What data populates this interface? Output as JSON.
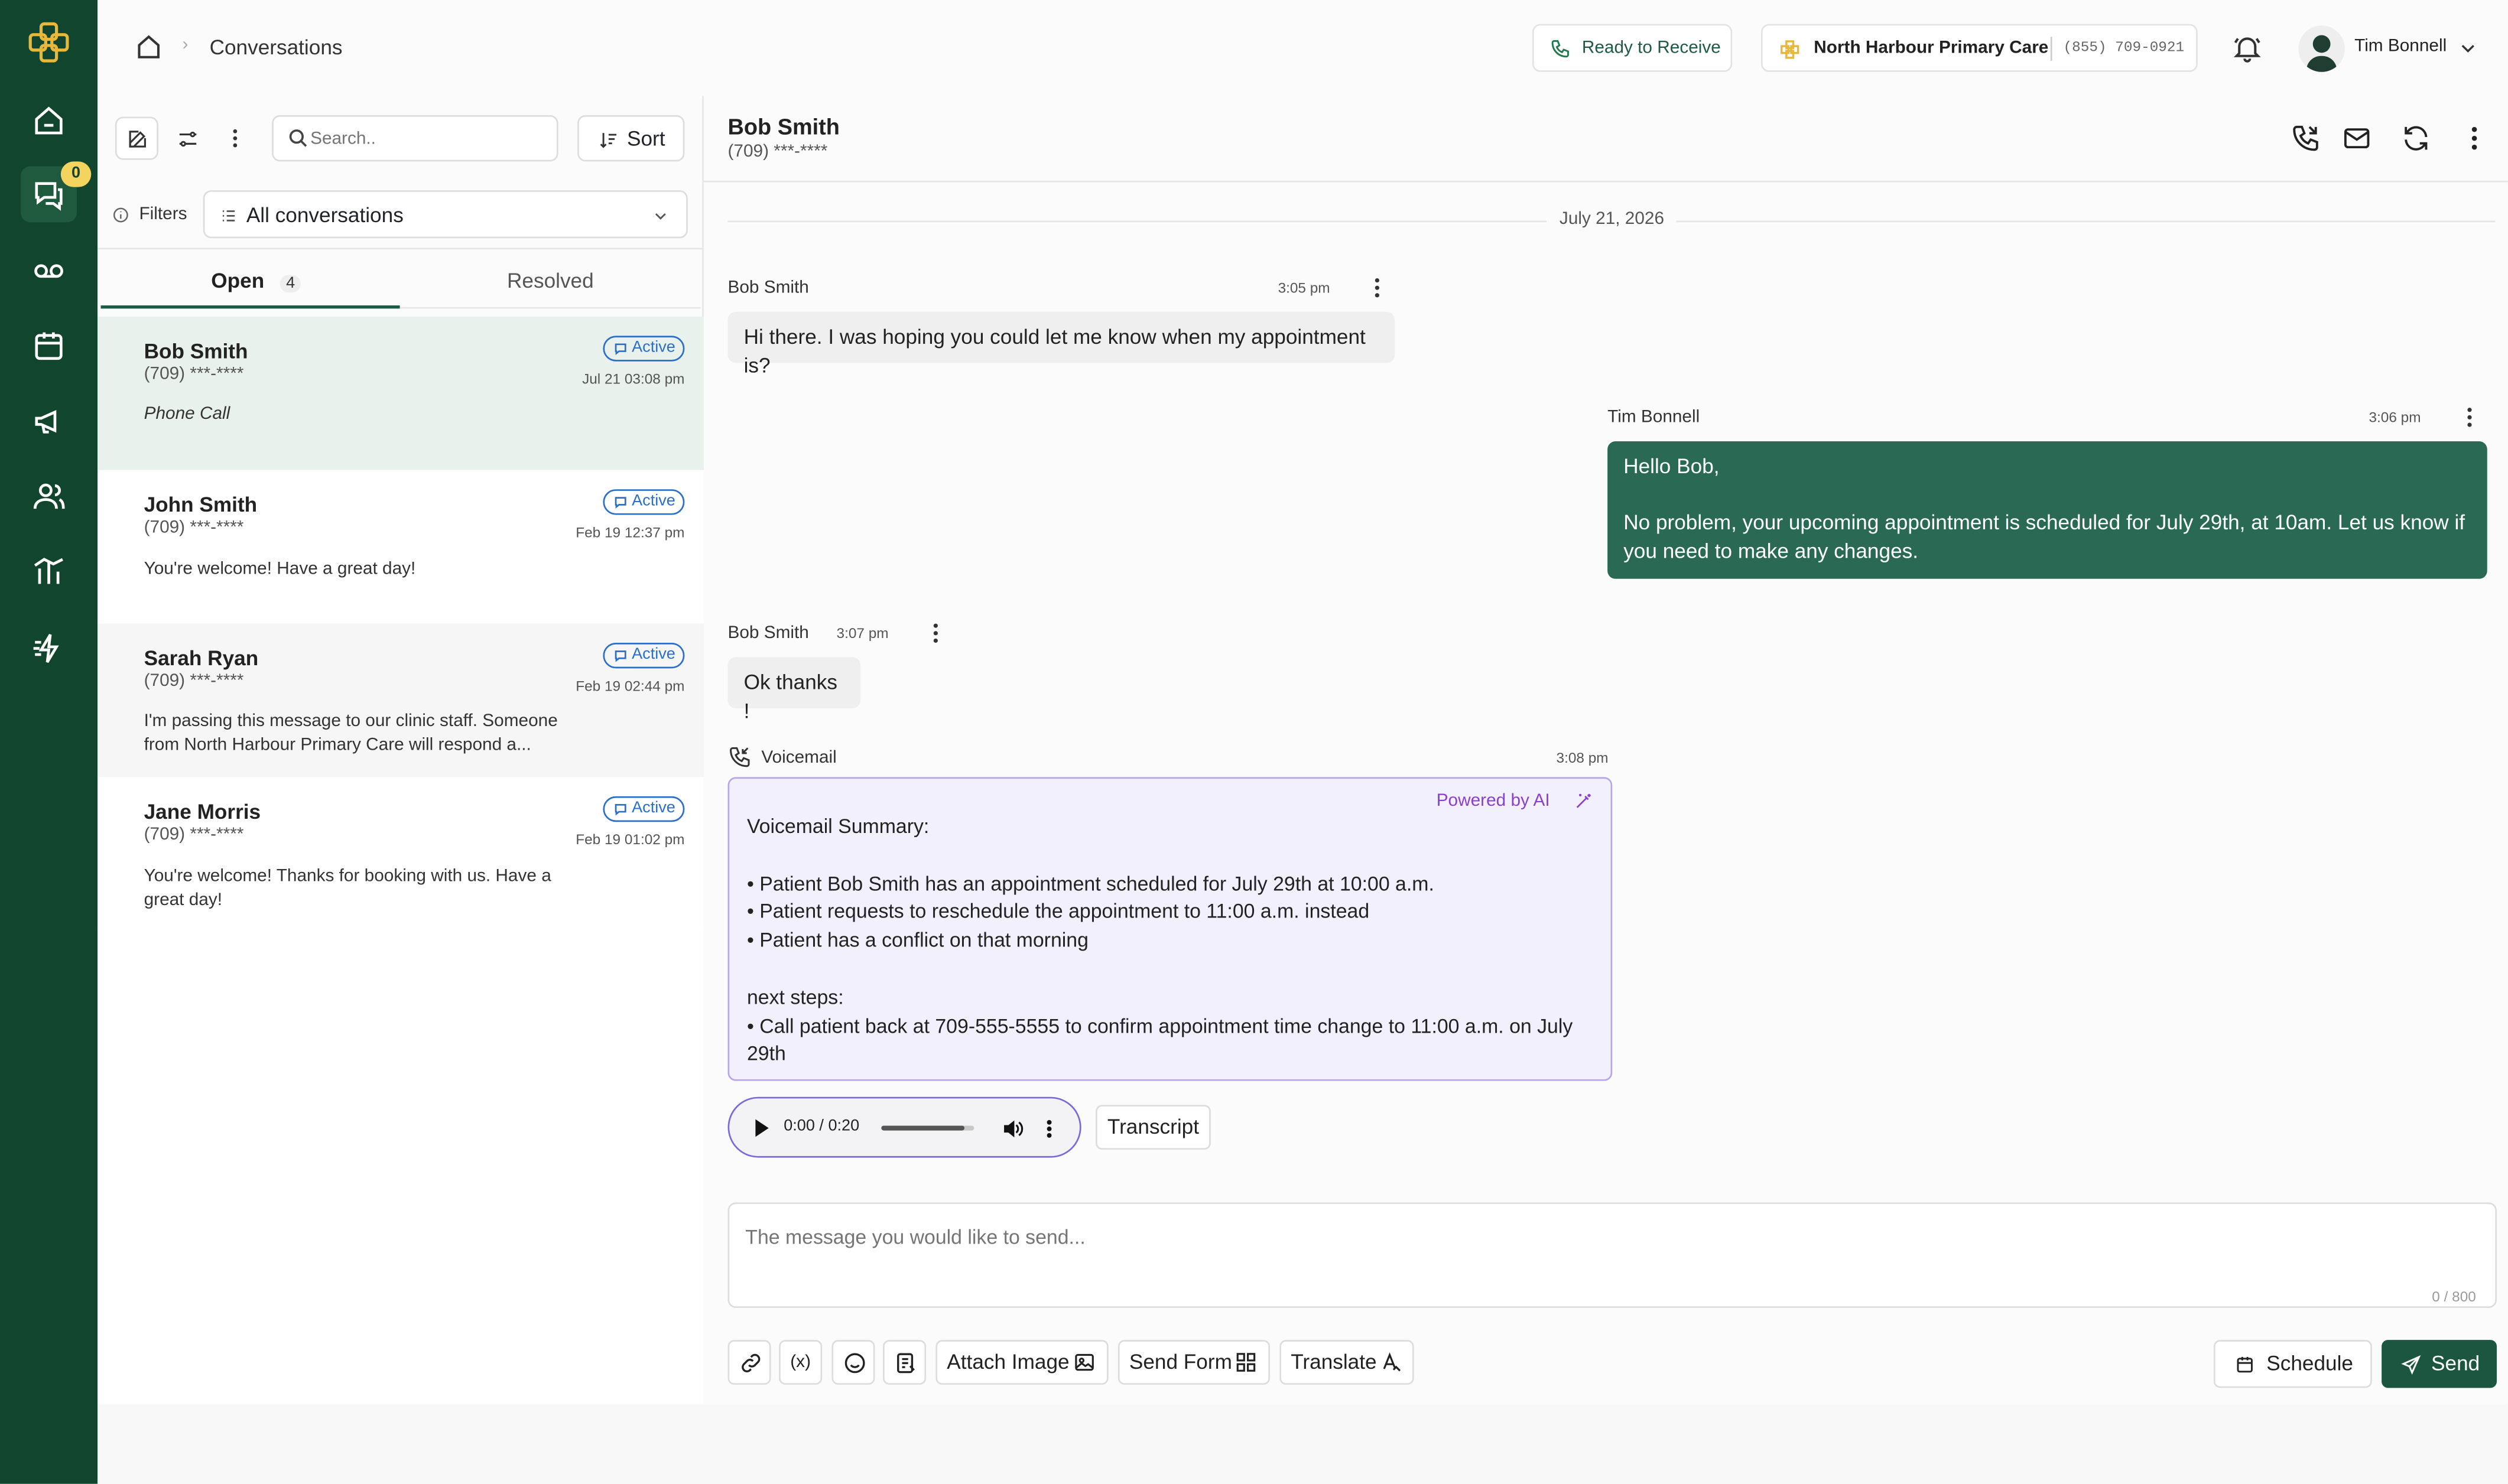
{
  "app": {
    "title": "Conversations",
    "notifications_count": "0"
  },
  "header": {
    "breadcrumb": "Conversations",
    "status": "Ready to Receive",
    "clinic_name": "North Harbour Primary Care",
    "clinic_phone": "(855) 709-0921",
    "user_name": "Tim Bonnell"
  },
  "list": {
    "search_placeholder": "Search..",
    "sort_label": "Sort",
    "filters_label": "Filters",
    "filter_value": "All conversations",
    "tabs": [
      {
        "label": "Open",
        "count": "4"
      },
      {
        "label": "Resolved"
      }
    ],
    "items": [
      {
        "name": "Bob Smith",
        "phone": "(709) ***-****",
        "status": "Active",
        "date": "Jul 21 03:08 pm",
        "preview": "Phone Call"
      },
      {
        "name": "John Smith",
        "phone": "(709) ***-****",
        "status": "Active",
        "date": "Feb 19 12:37 pm",
        "preview": "You're welcome! Have a great day!"
      },
      {
        "name": "Sarah Ryan",
        "phone": "(709) ***-****",
        "status": "Active",
        "date": "Feb 19 02:44 pm",
        "preview": "I'm passing this message to our clinic staff. Someone from North Harbour Primary Care will respond a..."
      },
      {
        "name": "Jane Morris",
        "phone": "(709) ***-****",
        "status": "Active",
        "date": "Feb 19 01:02 pm",
        "preview": "You're welcome! Thanks for booking with us. Have a great day!"
      }
    ]
  },
  "chat": {
    "contact_name": "Bob Smith",
    "contact_phone": "(709) ***-****",
    "date_divider": "July 21, 2026",
    "messages": [
      {
        "sender": "Bob Smith",
        "time": "3:05 pm",
        "text": "Hi there. I was hoping you could let me know when my appointment is?"
      },
      {
        "sender": "Tim Bonnell",
        "time": "3:06 pm",
        "line1": "Hello Bob,",
        "line2": "No problem, your upcoming appointment is scheduled for July 29th, at 10am. Let us know if you need to make any changes."
      },
      {
        "sender": "Bob Smith",
        "time": "3:07 pm",
        "text": "Ok thanks !"
      }
    ],
    "voicemail": {
      "label": "Voicemail",
      "time": "3:08 pm",
      "powered": "Powered by AI",
      "title": "Voicemail Summary:",
      "bullets": [
        "• Patient Bob Smith has an appointment scheduled for July 29th at 10:00 a.m.",
        "• Patient requests to reschedule the appointment to 11:00 a.m. instead",
        "• Patient has a conflict on that morning"
      ],
      "next_title": "next steps:",
      "next": "• Call patient back at 709-555-5555 to confirm appointment time change to 11:00 a.m. on July 29th",
      "audio_time": "0:00 / 0:20",
      "audio_progress": 0.9,
      "transcript": "Transcript"
    }
  },
  "composer": {
    "placeholder": "The message you would like to send...",
    "counter": "0 / 800",
    "attach_image": "Attach Image",
    "send_form": "Send Form",
    "translate": "Translate",
    "schedule": "Schedule",
    "send": "Send"
  },
  "colors": {
    "sidebar": "#12452e",
    "accent": "#1f5a46",
    "ai_purple": "#8a3fd1",
    "active_blue": "#2a6fc9"
  }
}
